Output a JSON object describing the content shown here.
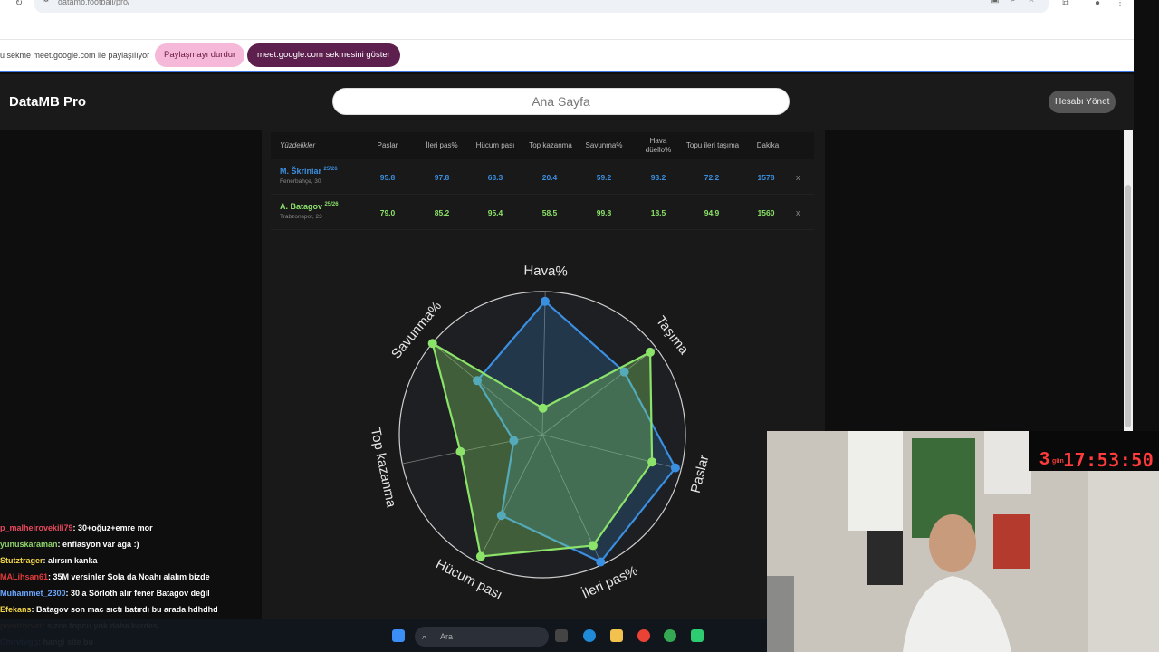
{
  "browser": {
    "url": "datamb.football/pro/"
  },
  "sharebar": {
    "message": "u sekme meet.google.com ile paylaşılıyor",
    "stop_label": "Paylaşmayı durdur",
    "show_label": "meet.google.com sekmesini göster"
  },
  "header": {
    "brand": "DataMB Pro",
    "search_placeholder": "Ana Sayfa",
    "manage_label": "Hesabı Yönet"
  },
  "table": {
    "columns": [
      "Yüzdelikler",
      "Paslar",
      "İleri pas%",
      "Hücum pası",
      "Top kazanma",
      "Savunma%",
      "Hava düello%",
      "Topu ileri taşıma",
      "Dakika"
    ],
    "rows": [
      {
        "name": "M. Škriniar",
        "season": "25/26",
        "club": "Fenerbahçe, 30",
        "values": [
          "95.8",
          "97.8",
          "63.3",
          "20.4",
          "59.2",
          "93.2",
          "72.2",
          "1578"
        ],
        "color": "#3b8fe0",
        "remove": "x"
      },
      {
        "name": "A. Batagov",
        "season": "25/26",
        "club": "Trabzonspor, 23",
        "values": [
          "79.0",
          "85.2",
          "95.4",
          "58.5",
          "99.8",
          "18.5",
          "94.9",
          "1560"
        ],
        "color": "#8ce36a",
        "remove": "x"
      }
    ]
  },
  "chart_data": {
    "type": "radar",
    "axes": [
      "Hava%",
      "Taşıma",
      "Paslar",
      "İleri pas%",
      "Hücum pası",
      "Top kazanma",
      "Savunma%"
    ],
    "range": [
      0,
      100
    ],
    "series": [
      {
        "name": "M. Škriniar",
        "color": "#3b8fe0",
        "values": [
          93.2,
          72.2,
          95.8,
          97.8,
          63.3,
          20.4,
          59.2
        ]
      },
      {
        "name": "A. Batagov",
        "color": "#8ce36a",
        "values": [
          18.5,
          94.9,
          79.0,
          85.2,
          95.4,
          58.5,
          99.8
        ]
      }
    ]
  },
  "chat": [
    {
      "user": "p_malheirovekili79",
      "color": "#e84a5f",
      "text": ": 30+oğuz+emre mor"
    },
    {
      "user": "yunuskaraman",
      "color": "#8fd46b",
      "text": ": enflasyon var aga :)"
    },
    {
      "user": "Stutztrager",
      "color": "#f2d64b",
      "text": ": alırsın kanka"
    },
    {
      "user": "MALihsan61",
      "color": "#e03b3b",
      "text": ": 35M versinler Sola da Noahı alalım bizde"
    },
    {
      "user": "Muhammet_2300",
      "color": "#6aa6ff",
      "text": ": 30 a Sörloth alır fener Batagov değil"
    },
    {
      "user": "Efekans",
      "color": "#f2d64b",
      "text": ": Batagov son mac sıctı batırdı bu arada hdhdhd"
    },
    {
      "user": "pivottorvet",
      "color": "#e8a04b",
      "text": ": sizce topcu yok daha kardes"
    },
    {
      "user": "Chirvtvgg",
      "color": "#6aa6ff",
      "text": ": hangi site bu"
    }
  ],
  "stream": {
    "timer_days": "gün",
    "timer_count": "3",
    "timer": "17:53:50"
  },
  "taskbar": {
    "search_label": "Ara"
  }
}
